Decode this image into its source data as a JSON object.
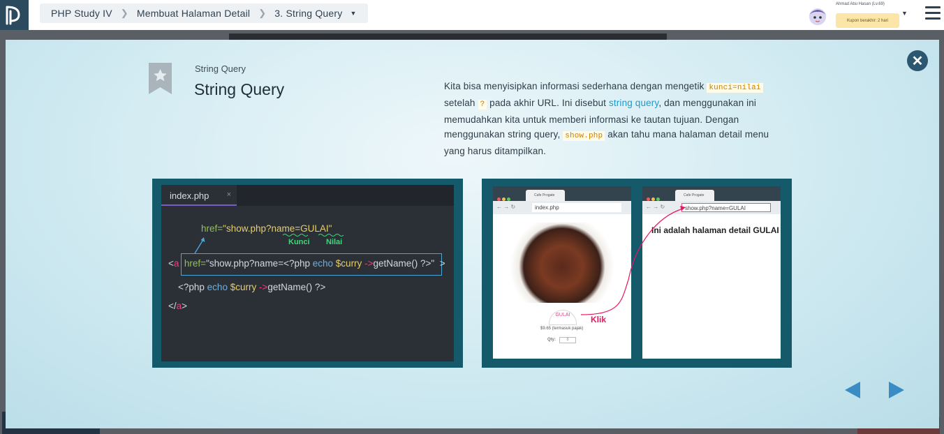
{
  "breadcrumb": {
    "course": "PHP Study IV",
    "chapter": "Membuat Halaman Detail",
    "lesson": "3. String Query"
  },
  "user": {
    "name": "Ahmad Abu Hasan (Lv.69)",
    "coupon": "Kupon berakhir: 2 hari"
  },
  "slide": {
    "subtitle": "String Query",
    "title": "String Query",
    "desc_1": "Kita bisa menyisipkan informasi sederhana dengan mengetik",
    "code_kunci": "kunci=nilai",
    "desc_2": "setelah",
    "code_q": "?",
    "desc_3": "pada akhir URL. Ini disebut",
    "link": "string query",
    "desc_4": ", dan menggunakan ini memudahkan kita untuk memberi informasi ke tautan tujuan. Dengan menggunakan string query,",
    "code_show": "show.php",
    "desc_5": "akan tahu mana halaman detail menu yang harus ditampilkan."
  },
  "code_panel": {
    "tab": "index.php",
    "tab_close": "×",
    "href_label": "href=",
    "href_value": "\"show.php?name=GULAI\"",
    "kunci": "Kunci",
    "nilai": "Nilai",
    "line1_open": "<",
    "line1_a": "a",
    "line1_href": "href=",
    "line1_str": "\"show.php?name=<?php ",
    "line1_echo": "echo",
    "line1_var": "$curry",
    "line1_arrow": "->",
    "line1_rest": "getName() ?>\"",
    "line1_close": ">",
    "line2_php": "<?php ",
    "line2_echo": "echo",
    "line2_var": "$curry",
    "line2_arrow": "->",
    "line2_rest": "getName() ?>",
    "line3_open": "</",
    "line3_a": "a",
    "line3_close": ">"
  },
  "browser_panel": {
    "left_url": "index.php",
    "right_url": "show.php?name=GULAI",
    "tab_title": "Cafe Progate",
    "food_name": "GULAI",
    "price": "$9.65 (termasuk pajak)",
    "qty_label": "Qty:",
    "qty_value": "0",
    "detail": "Ini adalah halaman detail GULAI",
    "klik": "Klik"
  },
  "icons": {
    "close": "close-icon",
    "prev": "prev-arrow-icon",
    "next": "next-arrow-icon"
  },
  "colors": {
    "accent": "#3a8dc4",
    "link": "#1b9bcc",
    "code_bg": "#2b2f36",
    "panel_bg": "#155a6a"
  }
}
